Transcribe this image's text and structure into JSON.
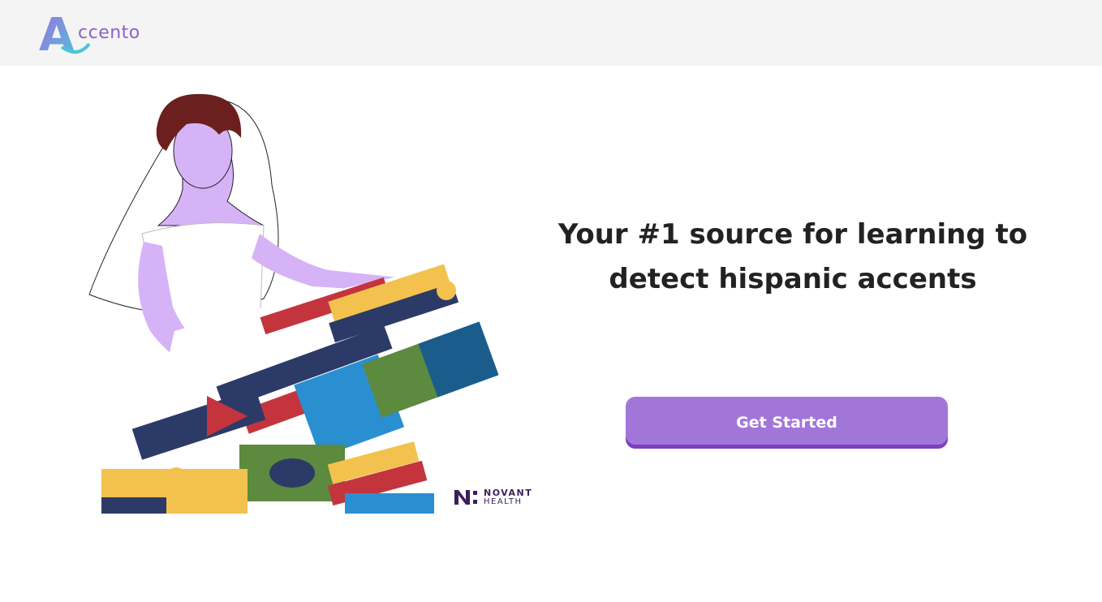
{
  "header": {
    "logo_letter": "A",
    "logo_text": "ccento"
  },
  "hero": {
    "headline": "Your #1 source for learning to detect hispanic accents",
    "cta_label": "Get Started",
    "brand_line1": "NOVANT",
    "brand_line2": "HEALTH"
  },
  "colors": {
    "header_bg": "#f4f4f4",
    "accent": "#a276d9",
    "accent_dark": "#7d3fbf",
    "headline_text": "#222222",
    "skin": "#d6b3f7",
    "hair": "#6b1f1f"
  },
  "icons": [
    "accento-logo",
    "woman-flag-dress-illustration",
    "novant-health-logo"
  ]
}
